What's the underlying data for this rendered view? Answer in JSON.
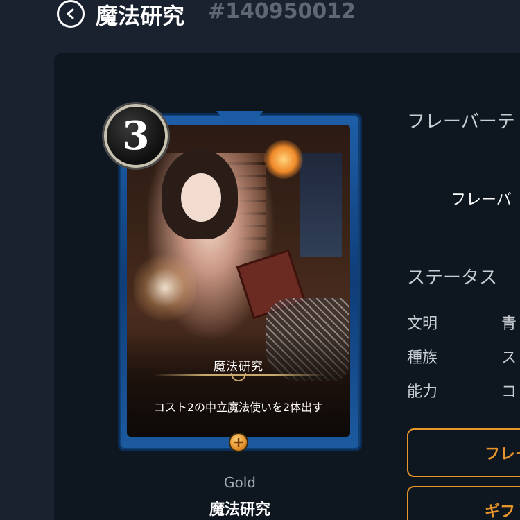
{
  "header": {
    "back_icon": "chevron-left-circle-icon",
    "title": "魔法研究",
    "card_id": "#140950012"
  },
  "card": {
    "cost": "3",
    "name": "魔法研究",
    "ability": "コスト2の中立魔法使いを2体出す",
    "rarity_icon": "gem-icon",
    "rarity": "Gold",
    "title": "魔法研究"
  },
  "details": {
    "flavor_heading": "フレーバーテ",
    "flavor_text": "フレーバ",
    "status_heading": "ステータス",
    "stats": [
      {
        "label": "文明",
        "value": "青"
      },
      {
        "label": "種族",
        "value": "ス"
      },
      {
        "label": "能力",
        "value": "コ"
      }
    ],
    "buttons": {
      "flavor_button": "フレー",
      "gift_button": "ギフト"
    }
  },
  "colors": {
    "background": "#1a2230",
    "panel": "#0e1620",
    "accent_orange": "#e8952c",
    "card_frame_blue": "#1e5fa8",
    "muted_text": "#5f6872"
  }
}
